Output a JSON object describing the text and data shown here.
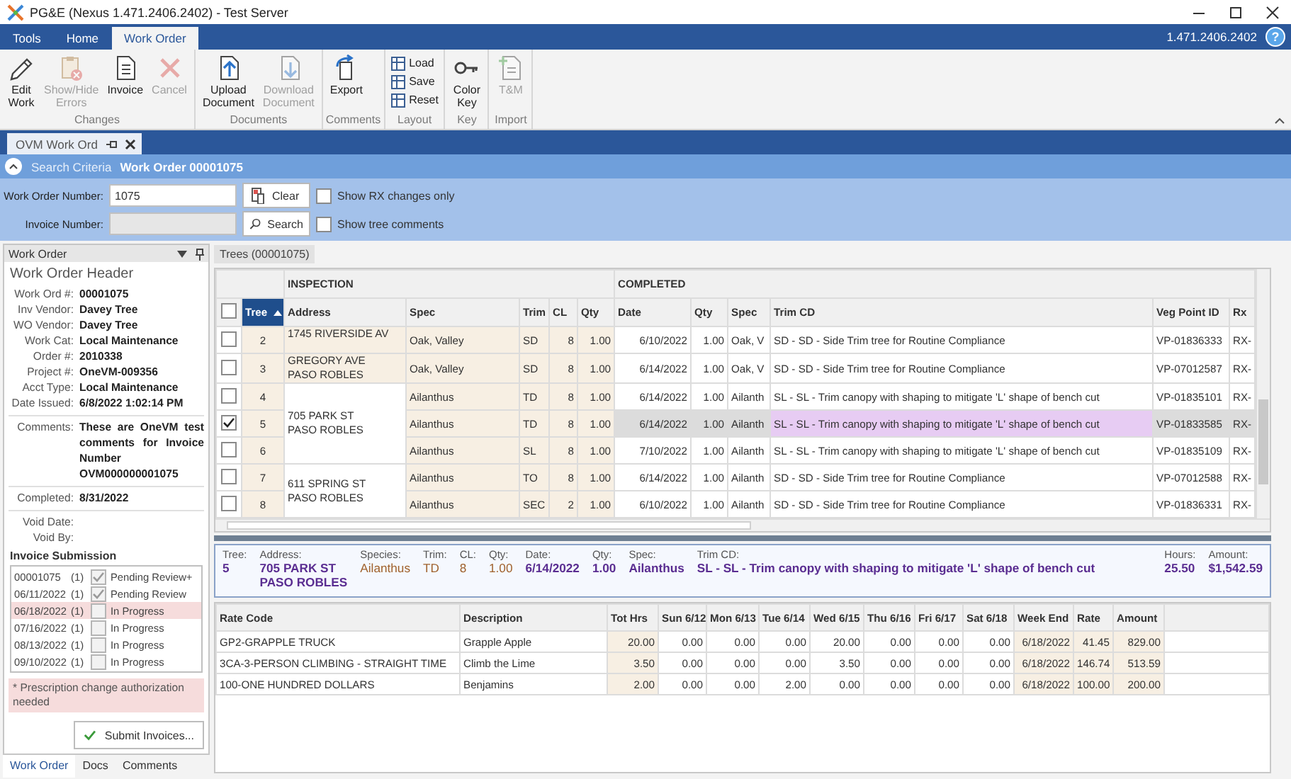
{
  "window": {
    "title": "PG&E (Nexus 1.471.2406.2402) - Test Server"
  },
  "ribbon": {
    "tabs": [
      {
        "label": "Tools",
        "selected": false
      },
      {
        "label": "Home",
        "selected": false
      },
      {
        "label": "Work Order",
        "selected": true
      }
    ],
    "version": "1.471.2406.2402",
    "help": "?",
    "groups": [
      {
        "label": "Changes",
        "kind": "large",
        "buttons": [
          {
            "label": "Edit\nWork",
            "kind": "edit",
            "disabled": false
          },
          {
            "label": "Show/Hide\nErrors",
            "kind": "errors",
            "disabled": true
          },
          {
            "label": "Invoice",
            "kind": "invoice",
            "disabled": false
          },
          {
            "label": "Cancel",
            "kind": "cancel",
            "disabled": true
          }
        ]
      },
      {
        "label": "Documents",
        "kind": "large",
        "buttons": [
          {
            "label": "Upload\nDocument",
            "kind": "upload",
            "disabled": false
          },
          {
            "label": "Download\nDocument",
            "kind": "download",
            "disabled": true
          }
        ]
      },
      {
        "label": "Comments",
        "kind": "large",
        "buttons": [
          {
            "label": "Export",
            "kind": "export",
            "disabled": false
          }
        ]
      },
      {
        "label": "Layout",
        "kind": "compact",
        "buttons": [
          {
            "label": "Load",
            "kind": "layout",
            "disabled": false
          },
          {
            "label": "Save",
            "kind": "layout",
            "disabled": false
          },
          {
            "label": "Reset",
            "kind": "layout",
            "disabled": false
          }
        ]
      },
      {
        "label": "Key",
        "kind": "large",
        "buttons": [
          {
            "label": "Color\nKey",
            "kind": "key",
            "disabled": false
          }
        ]
      },
      {
        "label": "Import",
        "kind": "large",
        "buttons": [
          {
            "label": "T&M",
            "kind": "import",
            "disabled": true
          }
        ]
      }
    ]
  },
  "document_tab": {
    "label": "OVM Work Ord"
  },
  "search": {
    "title": "Search Criteria",
    "subtitle": "Work Order 00001075",
    "work_order_number": {
      "label": "Work Order Number:",
      "value": "1075"
    },
    "invoice_number": {
      "label": "Invoice Number:",
      "disabled": true
    },
    "buttons": [
      {
        "label": "Clear",
        "kind": "clear"
      },
      {
        "label": "Search",
        "kind": "search"
      }
    ],
    "options": [
      {
        "label": "Show RX changes only",
        "checked": false
      },
      {
        "label": "Show tree comments",
        "checked": false
      }
    ]
  },
  "work_order": {
    "title": "Work Order",
    "header": "Work Order Header",
    "field_groups": [
      [
        {
          "label": "Work Ord #:",
          "value": "00001075"
        },
        {
          "label": "Inv Vendor:",
          "value": "Davey Tree"
        },
        {
          "label": "WO Vendor:",
          "value": "Davey Tree"
        },
        {
          "label": "Work Cat:",
          "value": "Local Maintenance"
        },
        {
          "label": "Order #:",
          "value": "2010338"
        },
        {
          "label": "Project #:",
          "value": "OneVM-009356"
        },
        {
          "label": "Acct Type:",
          "value": "Local Maintenance"
        },
        {
          "label": "Date Issued:",
          "value": "6/8/2022 1:02:14 PM"
        }
      ],
      [
        {
          "label": "Comments:",
          "value": "These are OneVM test comments for Invoice Number OVM000000001075"
        }
      ],
      [
        {
          "label": "Completed:",
          "value": "8/31/2022"
        }
      ],
      [
        {
          "label": "Void Date:"
        },
        {
          "label": "Void By:"
        }
      ]
    ],
    "invoice_submission": {
      "title": "Invoice Submission",
      "rows": [
        {
          "date": "00001075",
          "count": "(1)",
          "checked": true,
          "disabled": true,
          "status": "Pending Review+",
          "flagged": false
        },
        {
          "date": "06/11/2022",
          "count": "(1)",
          "checked": true,
          "disabled": true,
          "status": "Pending Review",
          "flagged": false
        },
        {
          "date": "06/18/2022",
          "count": "(1)",
          "checked": false,
          "disabled": true,
          "status": "In Progress",
          "flagged": true
        },
        {
          "date": "07/16/2022",
          "count": "(1)",
          "checked": false,
          "disabled": true,
          "status": "In Progress",
          "flagged": false
        },
        {
          "date": "08/13/2022",
          "count": "(1)",
          "checked": false,
          "disabled": true,
          "status": "In Progress",
          "flagged": false
        },
        {
          "date": "09/10/2022",
          "count": "(1)",
          "checked": false,
          "disabled": true,
          "status": "In Progress",
          "flagged": false
        }
      ]
    },
    "note": "* Prescription change authorization needed",
    "submit_button": "Submit Invoices...",
    "tabs": [
      {
        "label": "Work Order",
        "selected": true
      },
      {
        "label": "Docs",
        "selected": false
      },
      {
        "label": "Comments",
        "selected": false
      }
    ]
  },
  "trees": {
    "tab": "Trees (00001075)",
    "column_groups": [
      "INSPECTION",
      "COMPLETED"
    ],
    "all_checked": false,
    "columns": [
      {
        "label": "Tree",
        "sorted": true
      },
      {
        "label": "Address",
        "sorted": false
      },
      {
        "label": "Spec",
        "sorted": false
      },
      {
        "label": "Trim",
        "sorted": false
      },
      {
        "label": "CL",
        "sorted": false
      },
      {
        "label": "Qty",
        "sorted": false
      },
      {
        "label": "Date",
        "sorted": false
      },
      {
        "label": "Qty",
        "sorted": false
      },
      {
        "label": "Spec",
        "sorted": false
      },
      {
        "label": "Trim CD",
        "sorted": false
      },
      {
        "label": "Veg Point ID",
        "sorted": false
      },
      {
        "label": "Rx",
        "sorted": false
      }
    ],
    "address_groups": [
      {
        "address": "1745 RIVERSIDE AV",
        "rows": [
          {
            "tree": "2",
            "spec": "Oak, Valley",
            "trim": "SD",
            "cl": "8",
            "qty": "1.00",
            "date": "6/10/2022",
            "done_qty": "1.00",
            "done_spec": "Oak, V",
            "trim_cd": "SD - SD - Side Trim tree for Routine Compliance",
            "veg_point_id": "VP-01836333",
            "rx": "RX-",
            "checked": false,
            "selected": false
          }
        ]
      },
      {
        "address": "GREGORY AVE\nPASO ROBLES",
        "rows": [
          {
            "tree": "3",
            "spec": "Oak, Valley",
            "trim": "SD",
            "cl": "8",
            "qty": "1.00",
            "date": "6/14/2022",
            "done_qty": "1.00",
            "done_spec": "Oak, V",
            "trim_cd": "SD - SD - Side Trim tree for Routine Compliance",
            "veg_point_id": "VP-07012587",
            "rx": "RX-",
            "checked": false,
            "selected": false
          }
        ]
      },
      {
        "address": "705 PARK ST\nPASO ROBLES",
        "rows": [
          {
            "tree": "4",
            "spec": "Ailanthus",
            "trim": "TD",
            "cl": "8",
            "qty": "1.00",
            "date": "6/14/2022",
            "done_qty": "1.00",
            "done_spec": "Ailanth",
            "trim_cd": "SL - SL - Trim canopy with shaping to mitigate 'L' shape of bench cut",
            "veg_point_id": "VP-01835101",
            "rx": "RX-",
            "checked": false,
            "selected": false
          },
          {
            "tree": "5",
            "spec": "Ailanthus",
            "trim": "TD",
            "cl": "8",
            "qty": "1.00",
            "date": "6/14/2022",
            "done_qty": "1.00",
            "done_spec": "Ailanth",
            "trim_cd": "SL - SL - Trim canopy with shaping to mitigate 'L' shape of bench cut",
            "veg_point_id": "VP-01833585",
            "rx": "RX-",
            "checked": true,
            "selected": true
          },
          {
            "tree": "6",
            "spec": "Ailanthus",
            "trim": "SL",
            "cl": "8",
            "qty": "1.00",
            "date": "7/10/2022",
            "done_qty": "1.00",
            "done_spec": "Ailanth",
            "trim_cd": "SL - SL - Trim canopy with shaping to mitigate 'L' shape of bench cut",
            "veg_point_id": "VP-01835109",
            "rx": "RX-",
            "checked": false,
            "selected": false
          }
        ]
      },
      {
        "address": "611 SPRING ST\nPASO ROBLES",
        "rows": [
          {
            "tree": "7",
            "spec": "Ailanthus",
            "trim": "TO",
            "cl": "8",
            "qty": "1.00",
            "date": "6/14/2022",
            "done_qty": "1.00",
            "done_spec": "Ailanth",
            "trim_cd": "SD - SD - Side Trim tree for Routine Compliance",
            "veg_point_id": "VP-07012588",
            "rx": "RX-",
            "checked": false,
            "selected": false
          },
          {
            "tree": "8",
            "spec": "Ailanthus",
            "trim": "SEC",
            "cl": "2",
            "qty": "1.00",
            "date": "6/10/2022",
            "done_qty": "1.00",
            "done_spec": "Ailanth",
            "trim_cd": "SD - SD - Side Trim tree for Routine Compliance",
            "veg_point_id": "VP-01836331",
            "rx": "RX-",
            "checked": false,
            "selected": false
          }
        ]
      }
    ]
  },
  "tree_detail": {
    "fields": [
      {
        "label": "Tree:",
        "value": "5",
        "kind": "completed"
      },
      {
        "label": "Address:",
        "value": "705 PARK ST\nPASO ROBLES",
        "kind": "completed"
      },
      {
        "label": "Species:",
        "value": "Ailanthus",
        "kind": "inspection"
      },
      {
        "label": "Trim:",
        "value": "TD",
        "kind": "inspection"
      },
      {
        "label": "CL:",
        "value": "8",
        "kind": "inspection"
      },
      {
        "label": "Qty:",
        "value": "1.00",
        "kind": "inspection"
      },
      {
        "label": "Date:",
        "value": "6/14/2022",
        "kind": "completed"
      },
      {
        "label": "Qty:",
        "value": "1.00",
        "kind": "completed"
      },
      {
        "label": "Spec:",
        "value": "Ailanthus",
        "kind": "completed"
      },
      {
        "label": "Trim CD:",
        "value": "SL - SL - Trim canopy with shaping to mitigate 'L' shape of bench cut",
        "kind": "completed"
      },
      {
        "label": "Hours:",
        "value": "25.50",
        "kind": "completed"
      },
      {
        "label": "Amount:",
        "value": "$1,542.59",
        "kind": "completed"
      }
    ]
  },
  "rate_table": {
    "columns": [
      "Rate Code",
      "Description",
      "Tot Hrs",
      "Sun 6/12",
      "Mon 6/13",
      "Tue 6/14",
      "Wed 6/15",
      "Thu 6/16",
      "Fri 6/17",
      "Sat 6/18",
      "Week End",
      "Rate",
      "Amount"
    ],
    "rows": [
      [
        "GP2-GRAPPLE TRUCK",
        "Grapple Apple",
        "20.00",
        "0.00",
        "0.00",
        "0.00",
        "20.00",
        "0.00",
        "0.00",
        "0.00",
        "6/18/2022",
        "41.45",
        "829.00"
      ],
      [
        "3CA-3-PERSON CLIMBING - STRAIGHT TIME",
        "Climb the Lime",
        "3.50",
        "0.00",
        "0.00",
        "0.00",
        "3.50",
        "0.00",
        "0.00",
        "0.00",
        "6/18/2022",
        "146.74",
        "513.59"
      ],
      [
        "100-ONE HUNDRED DOLLARS",
        "Benjamins",
        "2.00",
        "0.00",
        "0.00",
        "2.00",
        "0.00",
        "0.00",
        "0.00",
        "0.00",
        "6/18/2022",
        "100.00",
        "200.00"
      ]
    ]
  }
}
